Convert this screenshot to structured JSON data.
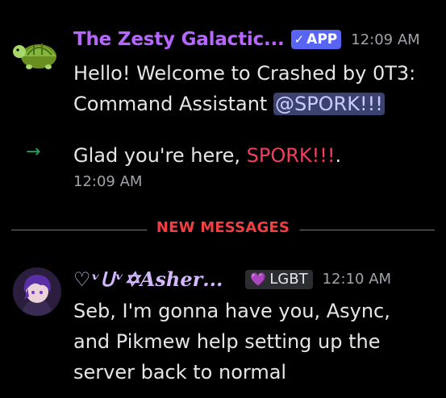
{
  "messages": [
    {
      "author": "The Zesty Galactic...",
      "badge": "APP",
      "badge_check": "✓",
      "time": "12:09 AM",
      "text_before": "Hello! Welcome to Crashed by 0T3:",
      "text_line2": "Command Assistant ",
      "mention": "@SPORK!!!",
      "avatar_icon": "turtle-icon"
    },
    {
      "system_arrow": "→",
      "text_prefix": "Glad you're here, ",
      "highlight": "SPORK!!!",
      "suffix": ".",
      "time": "12:09 AM"
    },
    {
      "author": "♡ᵛᑌᵛ✡𝑨𝒔𝒉𝒆𝒓...",
      "badge": "LGBT",
      "badge_icon": "💜",
      "time": "12:10 AM",
      "lines": [
        "Seb, I'm gonna have you, Async,",
        "and Pikmew help setting up the",
        "server back to normal"
      ],
      "avatar_icon": "anime-avatar"
    }
  ],
  "divider": {
    "label": "NEW MESSAGES"
  },
  "colors": {
    "background": "#000000",
    "app_name": "#b766ff",
    "app_badge": "#5865f2",
    "divider": "#f23f43",
    "mention_bg": "#3c4270",
    "join_arrow": "#23a55a"
  }
}
